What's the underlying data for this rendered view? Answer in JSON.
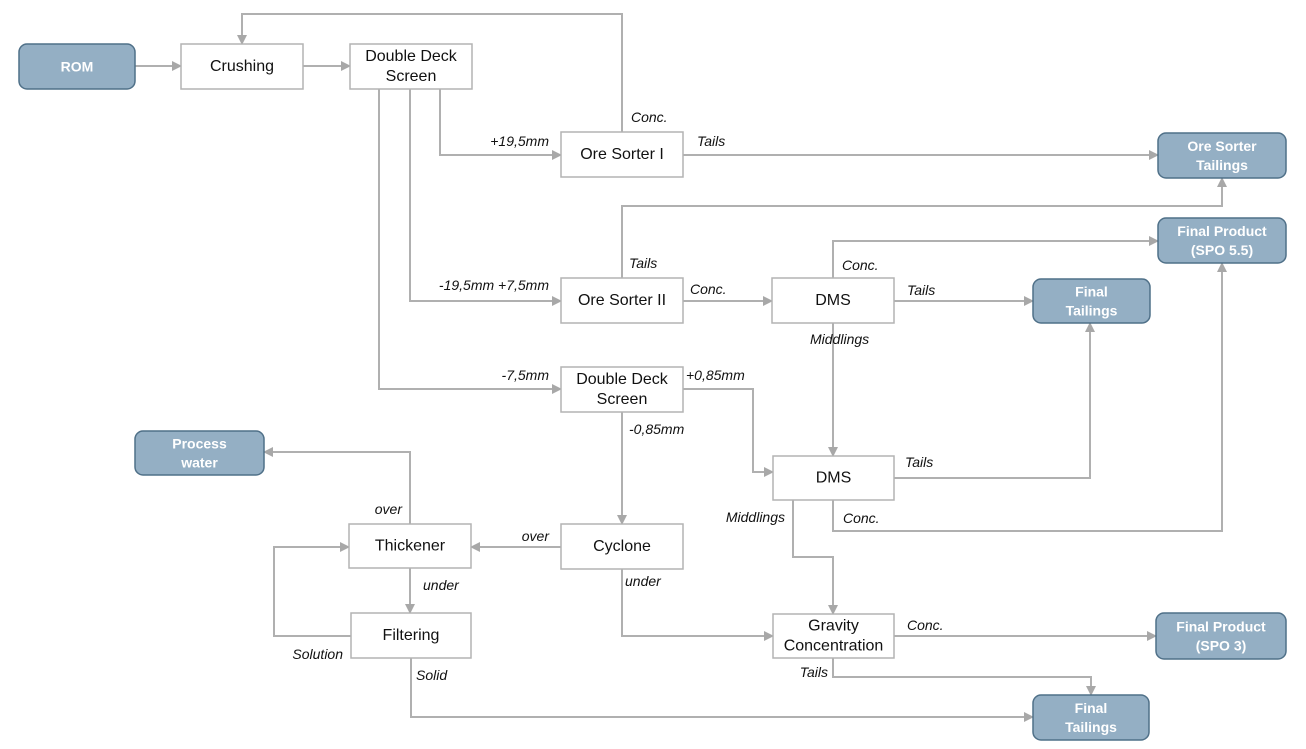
{
  "nodes": {
    "rom": {
      "lines": [
        "ROM"
      ],
      "kind": "terminal"
    },
    "crushing": {
      "lines": [
        "Crushing"
      ],
      "kind": "process"
    },
    "dds1": {
      "lines": [
        "Double Deck",
        "Screen"
      ],
      "kind": "process"
    },
    "os1": {
      "lines": [
        "Ore Sorter I"
      ],
      "kind": "process"
    },
    "ost": {
      "lines": [
        "Ore Sorter",
        "Tailings"
      ],
      "kind": "terminal"
    },
    "fp55": {
      "lines": [
        "Final Product",
        "(SPO 5.5)"
      ],
      "kind": "terminal"
    },
    "os2": {
      "lines": [
        "Ore Sorter II"
      ],
      "kind": "process"
    },
    "dms1": {
      "lines": [
        "DMS"
      ],
      "kind": "process"
    },
    "ft1": {
      "lines": [
        "Final",
        "Tailings"
      ],
      "kind": "terminal"
    },
    "dds2": {
      "lines": [
        "Double Deck",
        "Screen"
      ],
      "kind": "process"
    },
    "pw": {
      "lines": [
        "Process",
        "water"
      ],
      "kind": "terminal"
    },
    "dms2": {
      "lines": [
        "DMS"
      ],
      "kind": "process"
    },
    "thickener": {
      "lines": [
        "Thickener"
      ],
      "kind": "process"
    },
    "cyclone": {
      "lines": [
        "Cyclone"
      ],
      "kind": "process"
    },
    "filtering": {
      "lines": [
        "Filtering"
      ],
      "kind": "process"
    },
    "gravity": {
      "lines": [
        "Gravity",
        "Concentration"
      ],
      "kind": "process"
    },
    "fp3": {
      "lines": [
        "Final Product",
        "(SPO 3)"
      ],
      "kind": "terminal"
    },
    "ft2": {
      "lines": [
        "Final",
        "Tailings"
      ],
      "kind": "terminal"
    }
  },
  "edges": [
    {
      "id": "rom-crushing",
      "from": "rom",
      "to": "crushing",
      "label": ""
    },
    {
      "id": "crushing-dds1",
      "from": "crushing",
      "to": "dds1",
      "label": ""
    },
    {
      "id": "os1-crushing",
      "from": "os1",
      "to": "crushing",
      "label": "Conc."
    },
    {
      "id": "dds1-os1",
      "from": "dds1",
      "to": "os1",
      "label": "+19,5mm"
    },
    {
      "id": "os1-ost",
      "from": "os1",
      "to": "ost",
      "label": "Tails"
    },
    {
      "id": "dds1-os2",
      "from": "dds1",
      "to": "os2",
      "label": "-19,5mm +7,5mm"
    },
    {
      "id": "os2-ost",
      "from": "os2",
      "to": "ost",
      "label": "Tails"
    },
    {
      "id": "os2-dms1",
      "from": "os2",
      "to": "dms1",
      "label": "Conc."
    },
    {
      "id": "dms1-fp55",
      "from": "dms1",
      "to": "fp55",
      "label": "Conc."
    },
    {
      "id": "dms1-ft1",
      "from": "dms1",
      "to": "ft1",
      "label": "Tails"
    },
    {
      "id": "dms1-dms2",
      "from": "dms1",
      "to": "dms2",
      "label": "Middlings"
    },
    {
      "id": "dds1-dds2",
      "from": "dds1",
      "to": "dds2",
      "label": "-7,5mm"
    },
    {
      "id": "dds2-dms2",
      "from": "dds2",
      "to": "dms2",
      "label": "+0,85mm"
    },
    {
      "id": "dds2-cyclone",
      "from": "dds2",
      "to": "cyclone",
      "label": "-0,85mm"
    },
    {
      "id": "dms2-ft1",
      "from": "dms2",
      "to": "ft1",
      "label": "Tails"
    },
    {
      "id": "dms2-fp55",
      "from": "dms2",
      "to": "fp55",
      "label": "Conc."
    },
    {
      "id": "dms2-gravity",
      "from": "dms2",
      "to": "gravity",
      "label": "Middlings"
    },
    {
      "id": "thickener-pw",
      "from": "thickener",
      "to": "pw",
      "label": "over"
    },
    {
      "id": "cyclone-thickener",
      "from": "cyclone",
      "to": "thickener",
      "label": "over"
    },
    {
      "id": "thickener-filtering",
      "from": "thickener",
      "to": "filtering",
      "label": "under"
    },
    {
      "id": "filtering-thickener",
      "from": "filtering",
      "to": "thickener",
      "label": "Solution"
    },
    {
      "id": "cyclone-gravity",
      "from": "cyclone",
      "to": "gravity",
      "label": "under"
    },
    {
      "id": "gravity-fp3",
      "from": "gravity",
      "to": "fp3",
      "label": "Conc."
    },
    {
      "id": "gravity-ft2",
      "from": "gravity",
      "to": "ft2",
      "label": "Tails"
    },
    {
      "id": "filtering-ft2",
      "from": "filtering",
      "to": "ft2",
      "label": "Solid"
    }
  ],
  "colors": {
    "terminal_fill": "#94afc4",
    "terminal_border": "#4f7088",
    "process_border": "#b3b3b3",
    "connector": "#b0b0b0"
  }
}
